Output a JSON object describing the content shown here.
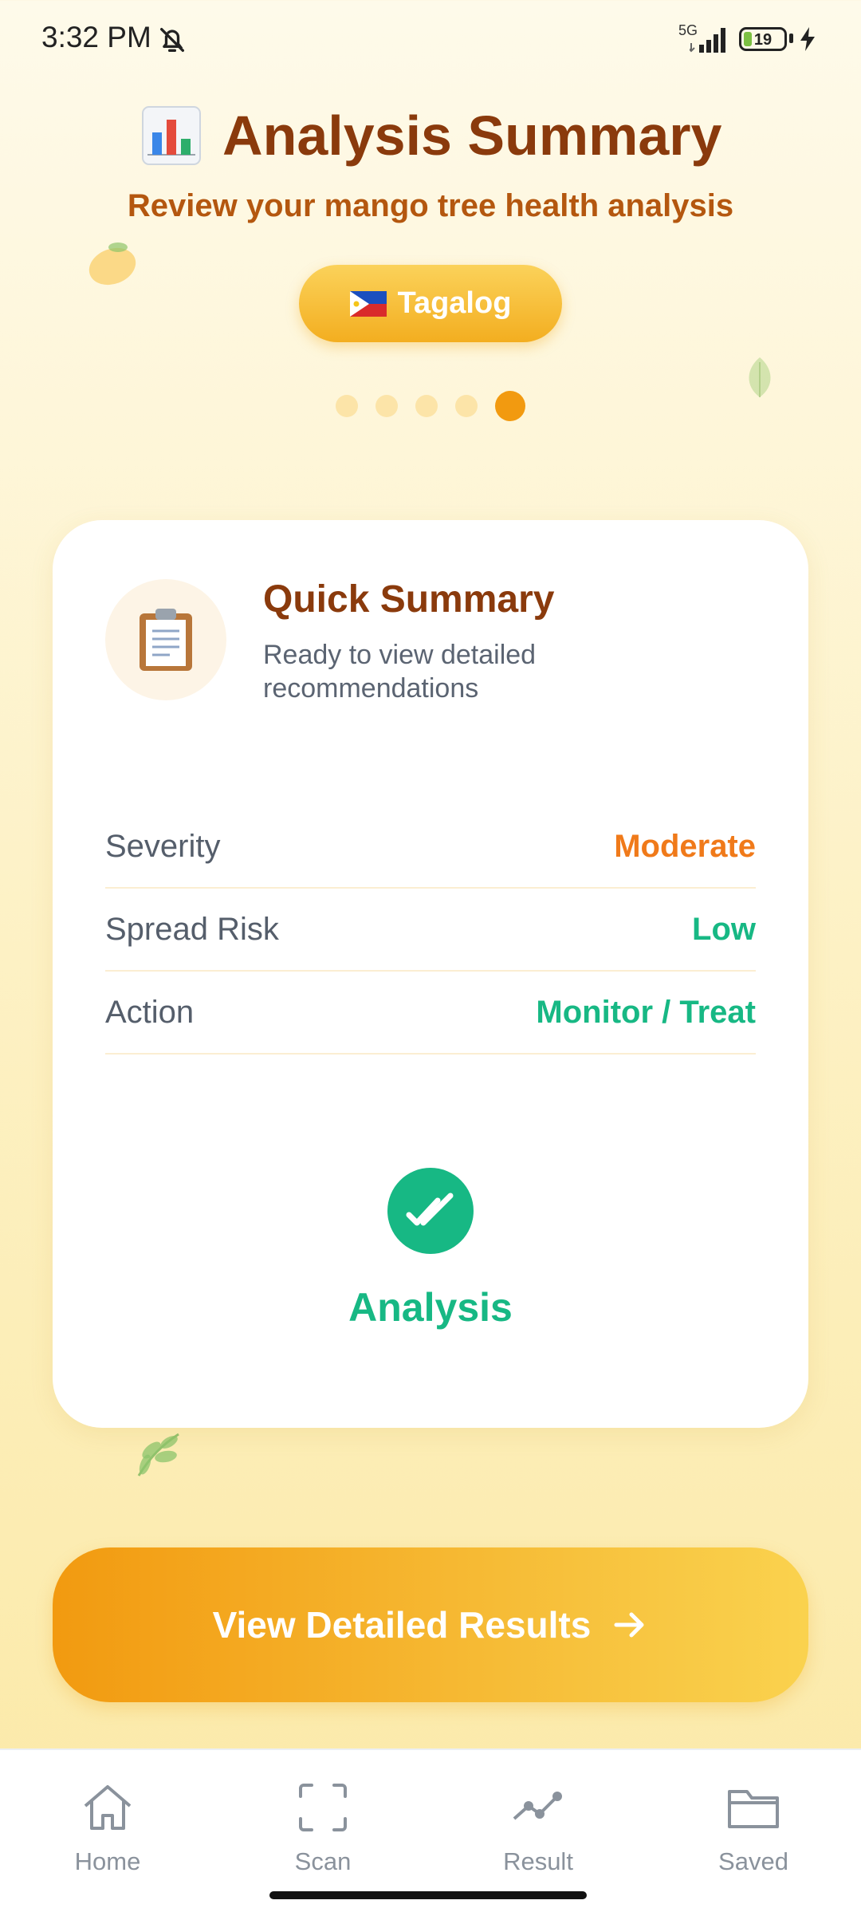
{
  "status_bar": {
    "time": "3:32 PM",
    "network": "5G",
    "battery": "19",
    "icons": [
      "bell-off-icon",
      "signal-icon",
      "battery-icon",
      "charging-icon"
    ]
  },
  "header": {
    "title": "Analysis Summary",
    "title_icon": "bar-chart-emoji",
    "subtitle": "Review your mango tree health analysis",
    "language_button": "Tagalog",
    "language_flag": "philippines-flag",
    "steps_total": 5,
    "active_step": 5
  },
  "summary": {
    "title": "Quick Summary",
    "subtitle": "Ready to view detailed recommendations",
    "icon": "clipboard-icon",
    "rows": [
      {
        "label": "Severity",
        "value": "Moderate",
        "color": "#f07a1a"
      },
      {
        "label": "Spread Risk",
        "value": "Low",
        "color": "#17b884"
      },
      {
        "label": "Action",
        "value": "Monitor / Treat",
        "color": "#17b884"
      }
    ],
    "status_label": "Analysis",
    "status_icon": "double-check-icon"
  },
  "cta": {
    "label": "View Detailed Results",
    "icon": "arrow-right-icon"
  },
  "nav": [
    {
      "label": "Home",
      "icon": "home-icon"
    },
    {
      "label": "Scan",
      "icon": "scan-icon"
    },
    {
      "label": "Result",
      "icon": "result-chart-icon"
    },
    {
      "label": "Saved",
      "icon": "folder-icon"
    }
  ],
  "colors": {
    "accent": "#f29a10",
    "title": "#8a3a0c",
    "success": "#17b884",
    "warning": "#f07a1a"
  }
}
